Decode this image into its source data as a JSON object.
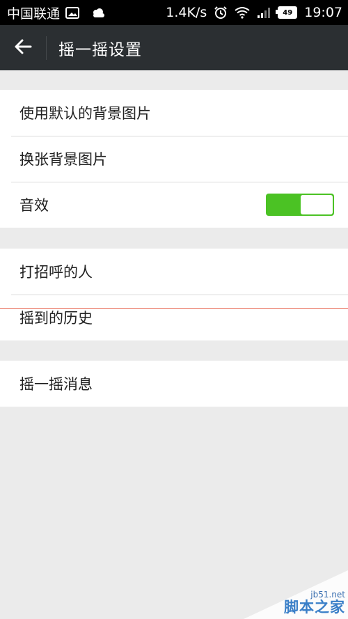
{
  "status_bar": {
    "carrier": "中国联通",
    "speed": "1.4K/s",
    "battery": "49",
    "time": "19:07",
    "icons": [
      "image-icon",
      "cloud-icon",
      "alarm-icon",
      "wifi-icon",
      "signal-icon",
      "battery-icon"
    ]
  },
  "topbar": {
    "back_icon": "back-arrow-icon",
    "title": "摇一摇设置"
  },
  "settings": {
    "group1": [
      {
        "label": "使用默认的背景图片"
      },
      {
        "label": "换张背景图片"
      },
      {
        "label": "音效",
        "toggle": true
      }
    ],
    "group2": [
      {
        "label": "打招呼的人"
      },
      {
        "label": "摇到的历史"
      }
    ],
    "group3": [
      {
        "label": "摇一摇消息"
      }
    ]
  },
  "colors": {
    "toggle_on": "#4bc224",
    "topbar_bg": "#2b2f32",
    "page_bg": "#ebebeb"
  },
  "watermark": {
    "url": "jb51.net",
    "text": "脚本之家"
  }
}
